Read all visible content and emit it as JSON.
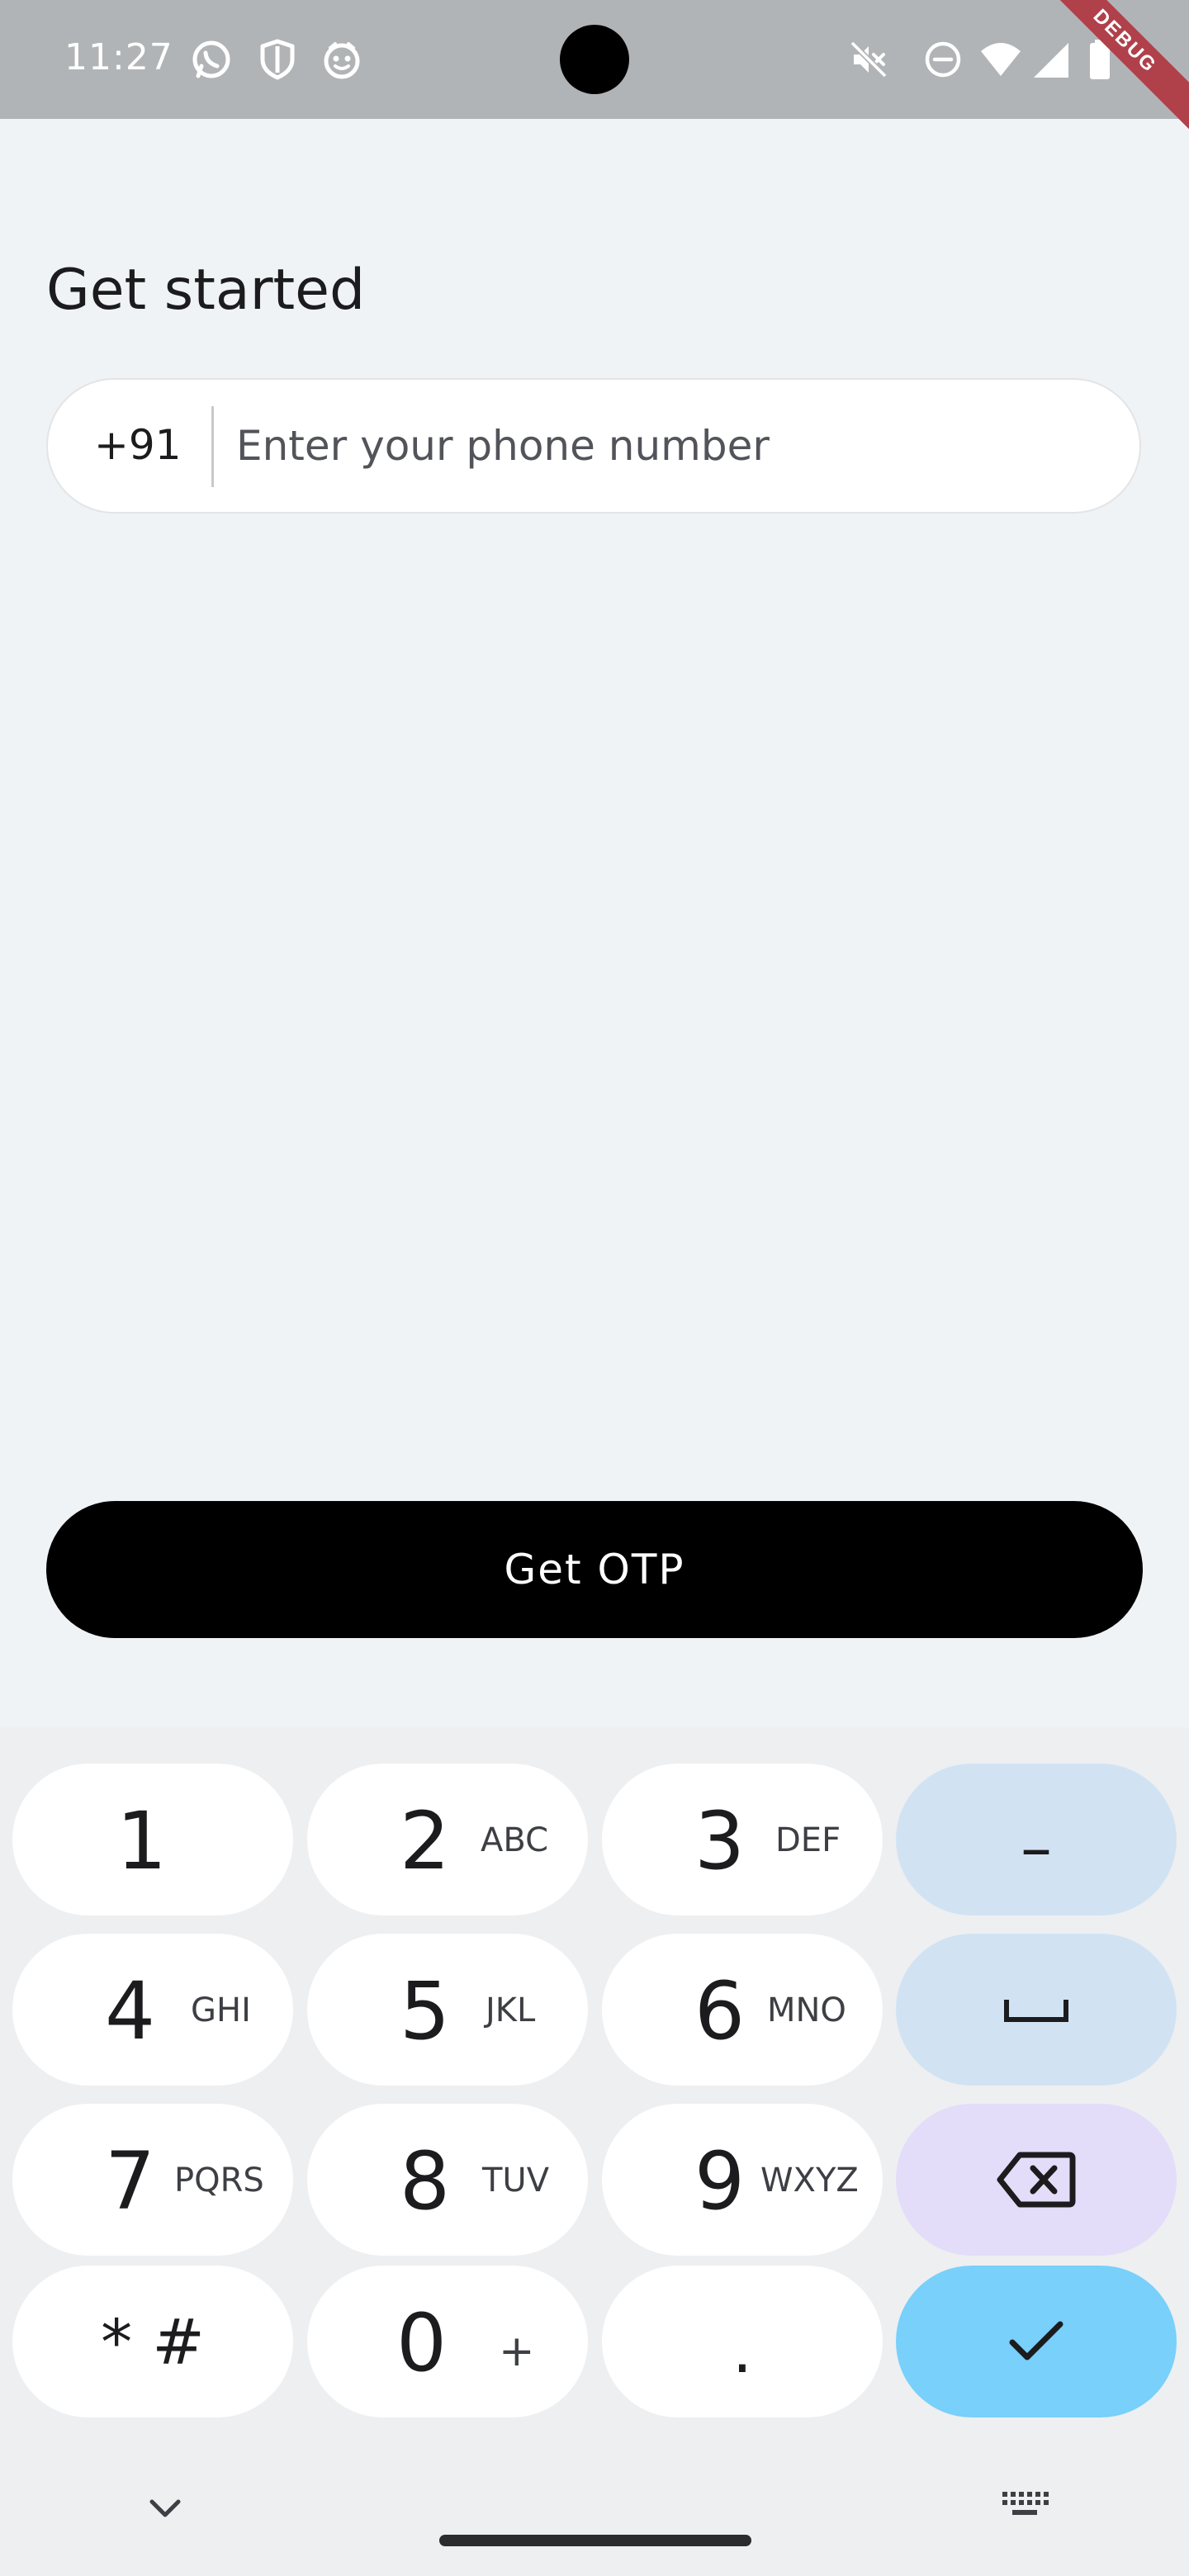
{
  "status_bar": {
    "time": "11:27",
    "debug_label": "DEBUG",
    "left_icons": [
      "whatsapp-icon",
      "shield-icon",
      "smiley-icon"
    ],
    "right_icons": [
      "mute-icon",
      "do-not-disturb-icon",
      "wifi-icon",
      "signal-icon",
      "battery-icon"
    ]
  },
  "page": {
    "title": "Get started"
  },
  "phone_field": {
    "country_code": "+91",
    "value": "",
    "placeholder": "Enter your phone number"
  },
  "otp_button": {
    "label": "Get OTP",
    "color": "#000000"
  },
  "keyboard": {
    "rows": [
      [
        {
          "digit": "1",
          "letters": ""
        },
        {
          "digit": "2",
          "letters": "ABC"
        },
        {
          "digit": "3",
          "letters": "DEF"
        },
        {
          "symbol": "–",
          "name": "dash-key"
        }
      ],
      [
        {
          "digit": "4",
          "letters": "GHI"
        },
        {
          "digit": "5",
          "letters": "JKL"
        },
        {
          "digit": "6",
          "letters": "MNO"
        },
        {
          "icon": "space-icon",
          "name": "space-key"
        }
      ],
      [
        {
          "digit": "7",
          "letters": "PQRS"
        },
        {
          "digit": "8",
          "letters": "TUV"
        },
        {
          "digit": "9",
          "letters": "WXYZ"
        },
        {
          "icon": "backspace-icon",
          "name": "backspace-key"
        }
      ],
      [
        {
          "symbol": "* #",
          "name": "star-hash-key"
        },
        {
          "digit": "0",
          "letters": "+"
        },
        {
          "symbol": ".",
          "name": "period-key"
        },
        {
          "icon": "checkmark-icon",
          "name": "done-key"
        }
      ]
    ],
    "colors": {
      "key": "#ffffff",
      "action_blue": "#d1e3f3",
      "action_purple": "#e3ddf9",
      "done": "#78d0fb"
    },
    "nav_icons": [
      "chevron-down-icon",
      "keyboard-icon"
    ]
  }
}
